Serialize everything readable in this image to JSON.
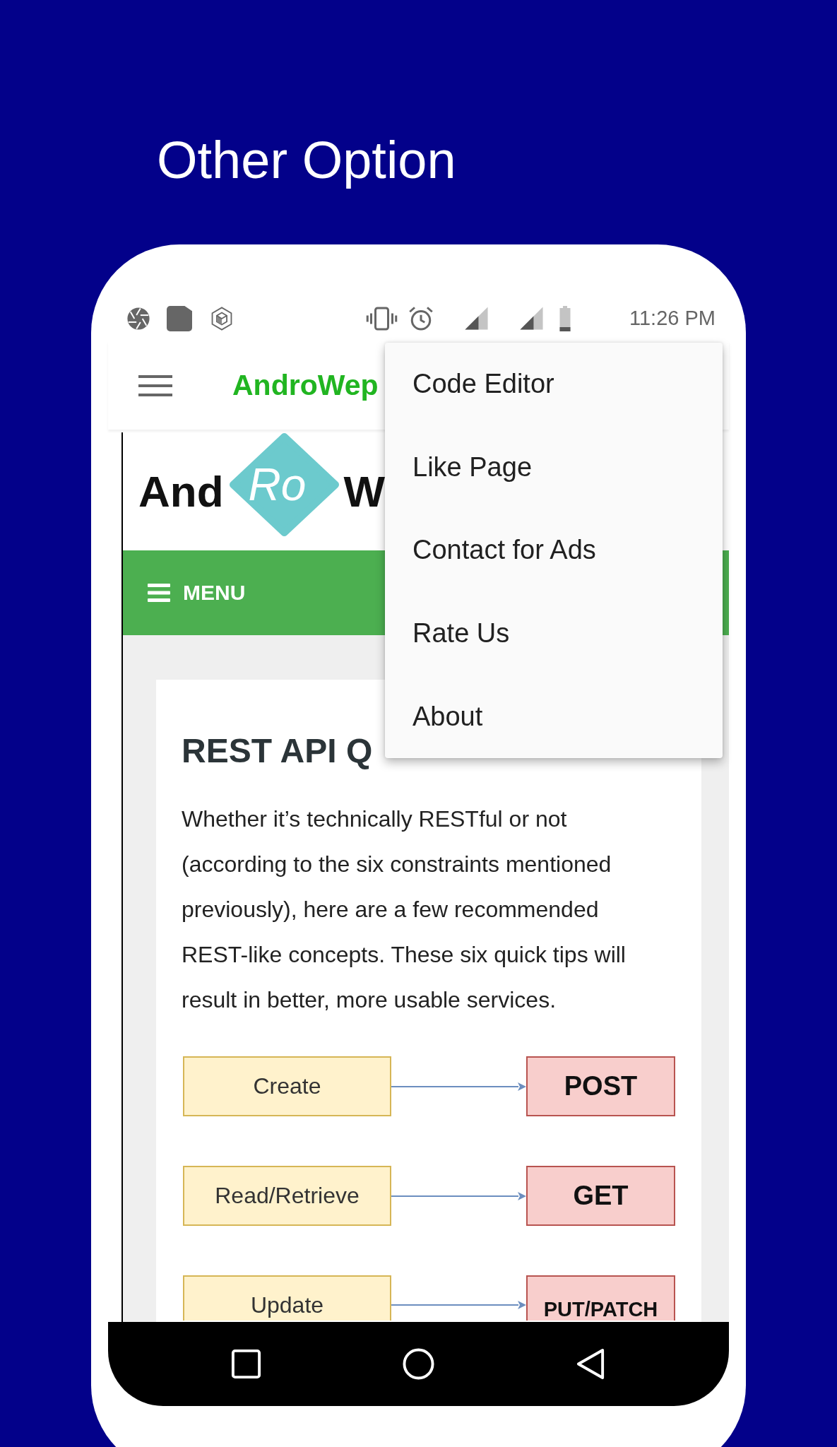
{
  "header": {
    "title": "Other Option"
  },
  "status_bar": {
    "time": "11:26 PM"
  },
  "app_bar": {
    "title": "AndroWep"
  },
  "website": {
    "logo": {
      "left": "And",
      "badge": "Ro",
      "right": "W"
    },
    "menu_bar": {
      "label": "MENU"
    }
  },
  "article": {
    "heading": "REST API Q",
    "paragraph": "Whether it’s technically RESTful or not (according to the six constraints mentioned previously), here are a few recommended REST-like concepts. These six quick tips will result in better, more usable services.",
    "diagram": [
      {
        "operation": "Create",
        "method": "POST"
      },
      {
        "operation": "Read/Retrieve",
        "method": "GET"
      },
      {
        "operation": "Update",
        "method": "PUT/PATCH"
      }
    ]
  },
  "popup_menu": {
    "items": [
      "Code Editor",
      "Like Page",
      "Contact for Ads",
      "Rate Us",
      "About"
    ]
  }
}
